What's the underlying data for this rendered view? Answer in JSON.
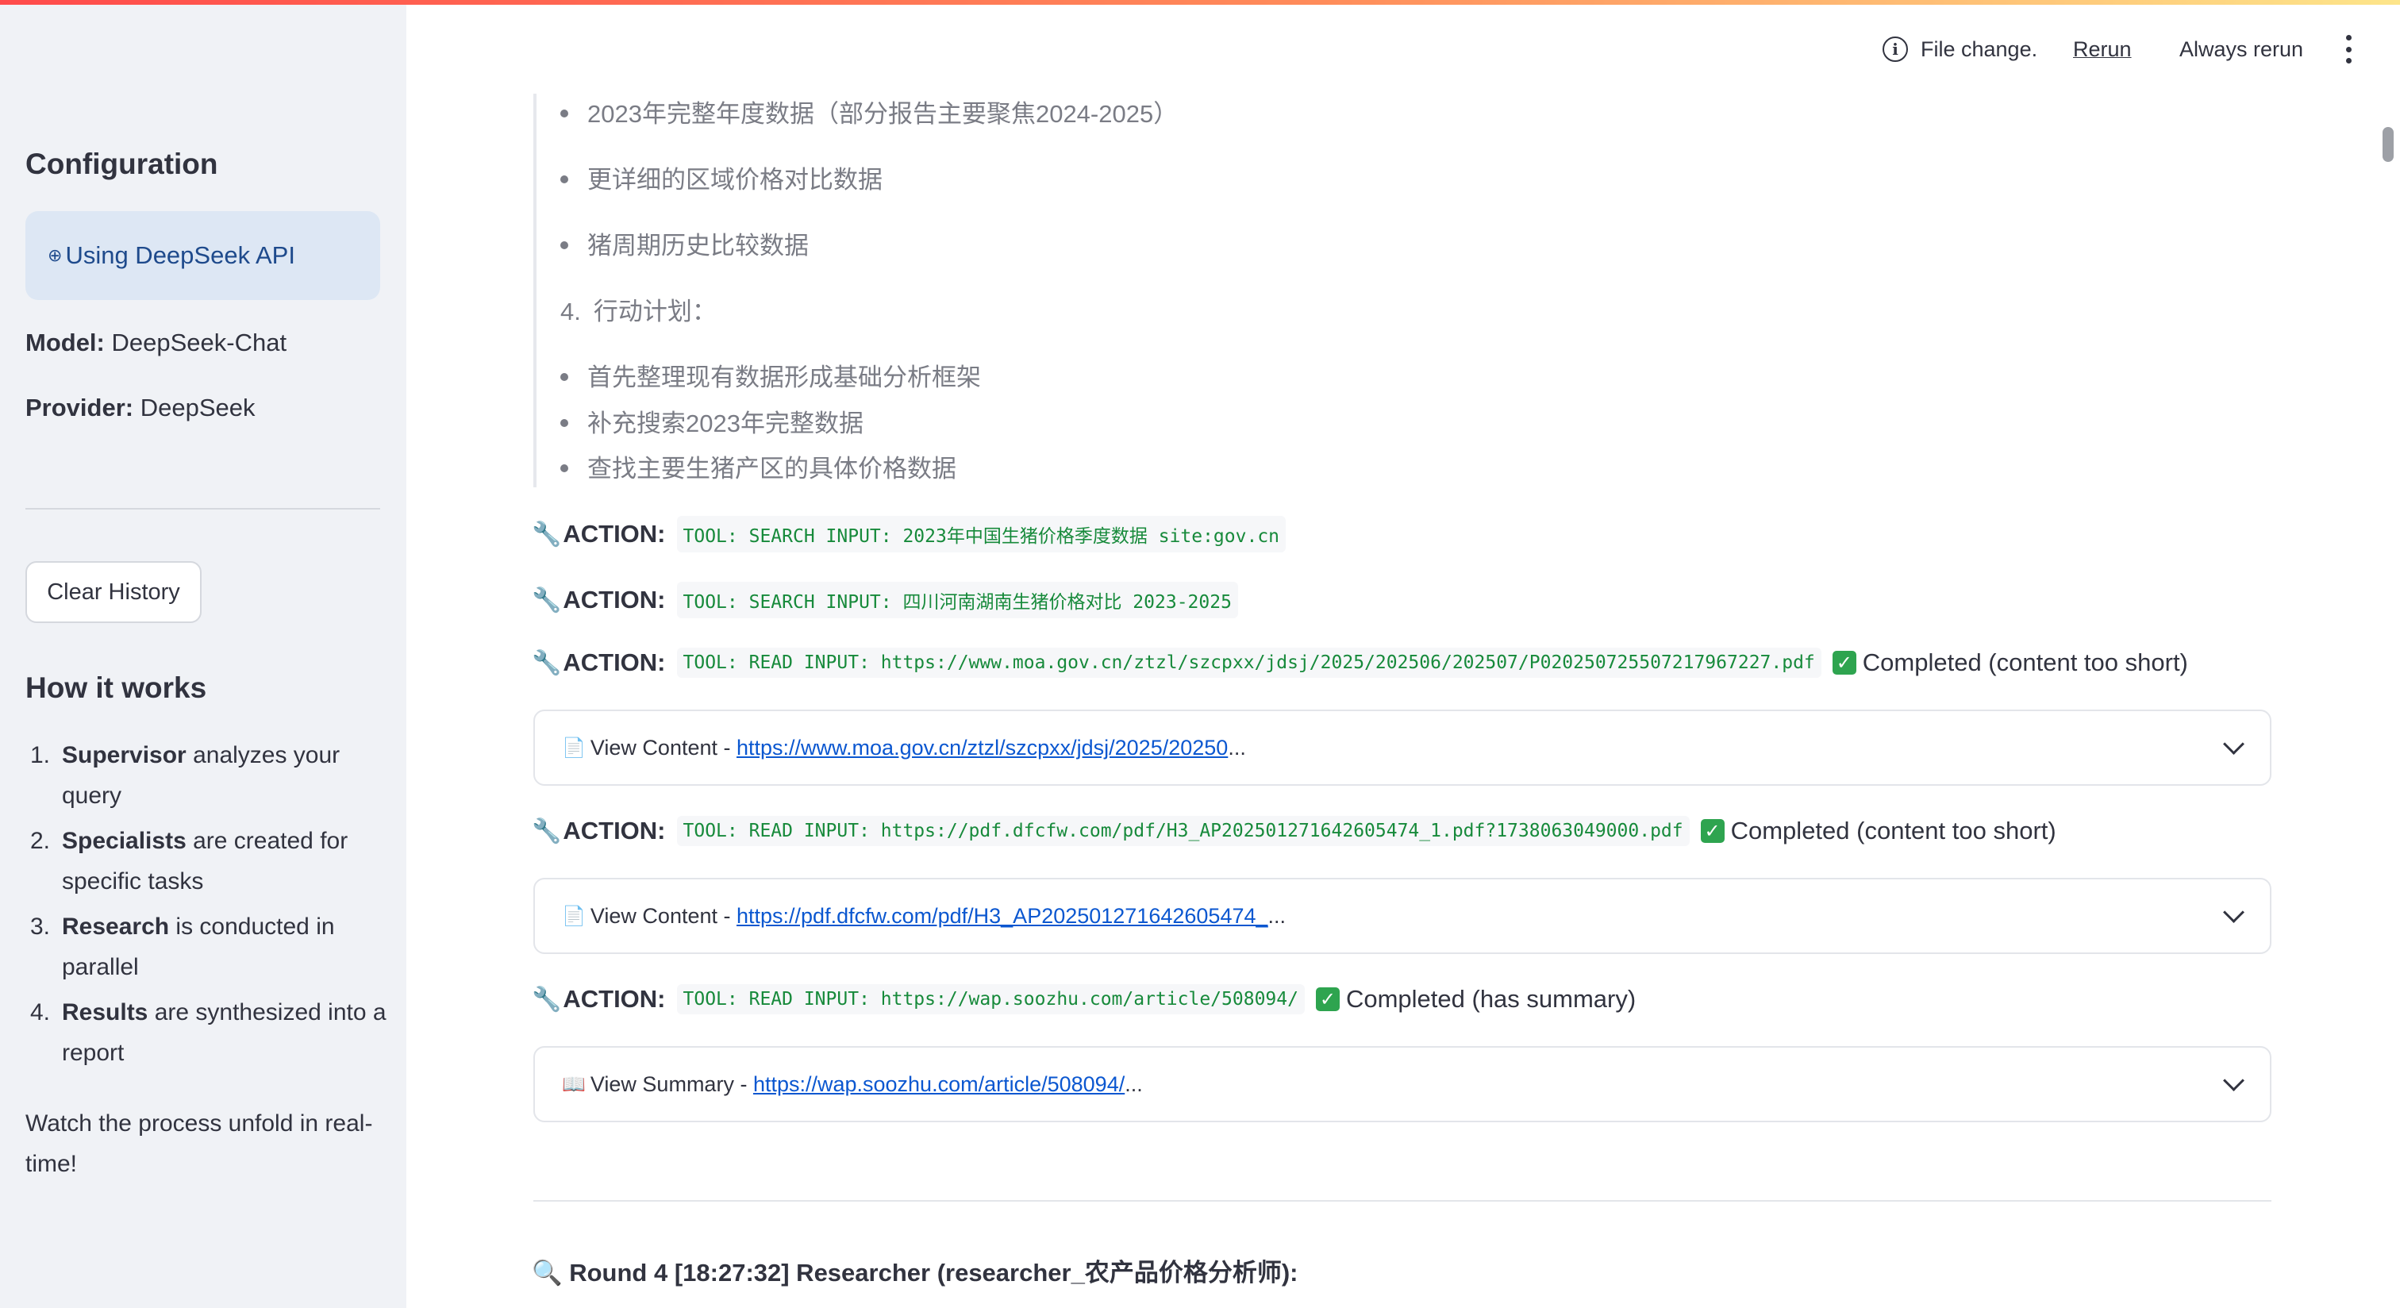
{
  "sidebar": {
    "config_heading": "Configuration",
    "api_notice": "Using DeepSeek API",
    "model_label": "Model:",
    "model_value": "DeepSeek-Chat",
    "provider_label": "Provider:",
    "provider_value": "DeepSeek",
    "clear_button": "Clear History",
    "how_heading": "How it works",
    "steps": [
      {
        "num": "1.",
        "bold": "Supervisor",
        "text": " analyzes your query"
      },
      {
        "num": "2.",
        "bold": "Specialists",
        "text": " are created for specific tasks"
      },
      {
        "num": "3.",
        "bold": "Research",
        "text": " is conducted in parallel"
      },
      {
        "num": "4.",
        "bold": "Results",
        "text": " are synthesized into a report"
      }
    ],
    "footer": "Watch the process unfold in real-time!"
  },
  "toolbar": {
    "file_change": "File change.",
    "rerun": "Rerun",
    "always_rerun": "Always rerun"
  },
  "content": {
    "bullets_a": [
      "2023年完整年度数据（部分报告主要聚焦2024-2025）",
      "更详细的区域价格对比数据",
      "猪周期历史比较数据"
    ],
    "section4_num": "4.",
    "section4_label": "行动计划：",
    "bullets_b": [
      "首先整理现有数据形成基础分析框架",
      "补充搜索2023年完整数据",
      "查找主要生猪产区的具体价格数据"
    ],
    "action_label": "ACTION:",
    "actions": [
      {
        "code": "TOOL: SEARCH INPUT: 2023年中国生猪价格季度数据 site:gov.cn",
        "status": ""
      },
      {
        "code": "TOOL: SEARCH INPUT: 四川河南湖南生猪价格对比 2023-2025",
        "status": ""
      },
      {
        "code": "TOOL: READ INPUT: https://www.moa.gov.cn/ztzl/szcpxx/jdsj/2025/202506/202507/P020250725507217967227.pdf",
        "status": "Completed (content too short)"
      },
      {
        "code": "TOOL: READ INPUT: https://pdf.dfcfw.com/pdf/H3_AP202501271642605474_1.pdf?1738063049000.pdf",
        "status": "Completed (content too short)"
      },
      {
        "code": "TOOL: READ INPUT: https://wap.soozhu.com/article/508094/",
        "status": "Completed (has summary)"
      }
    ],
    "expanders": [
      {
        "prefix": "View Content - ",
        "link": "https://www.moa.gov.cn/ztzl/szcpxx/jdsj/2025/20250",
        "suffix": "..."
      },
      {
        "prefix": "View Content - ",
        "link": "https://pdf.dfcfw.com/pdf/H3_AP202501271642605474_",
        "suffix": "..."
      },
      {
        "prefix": "View Summary - ",
        "link": "https://wap.soozhu.com/article/508094/",
        "suffix": "..."
      }
    ],
    "round_heading": "Round 4 [18:27:32] Researcher (researcher_农产品价格分析师):"
  }
}
